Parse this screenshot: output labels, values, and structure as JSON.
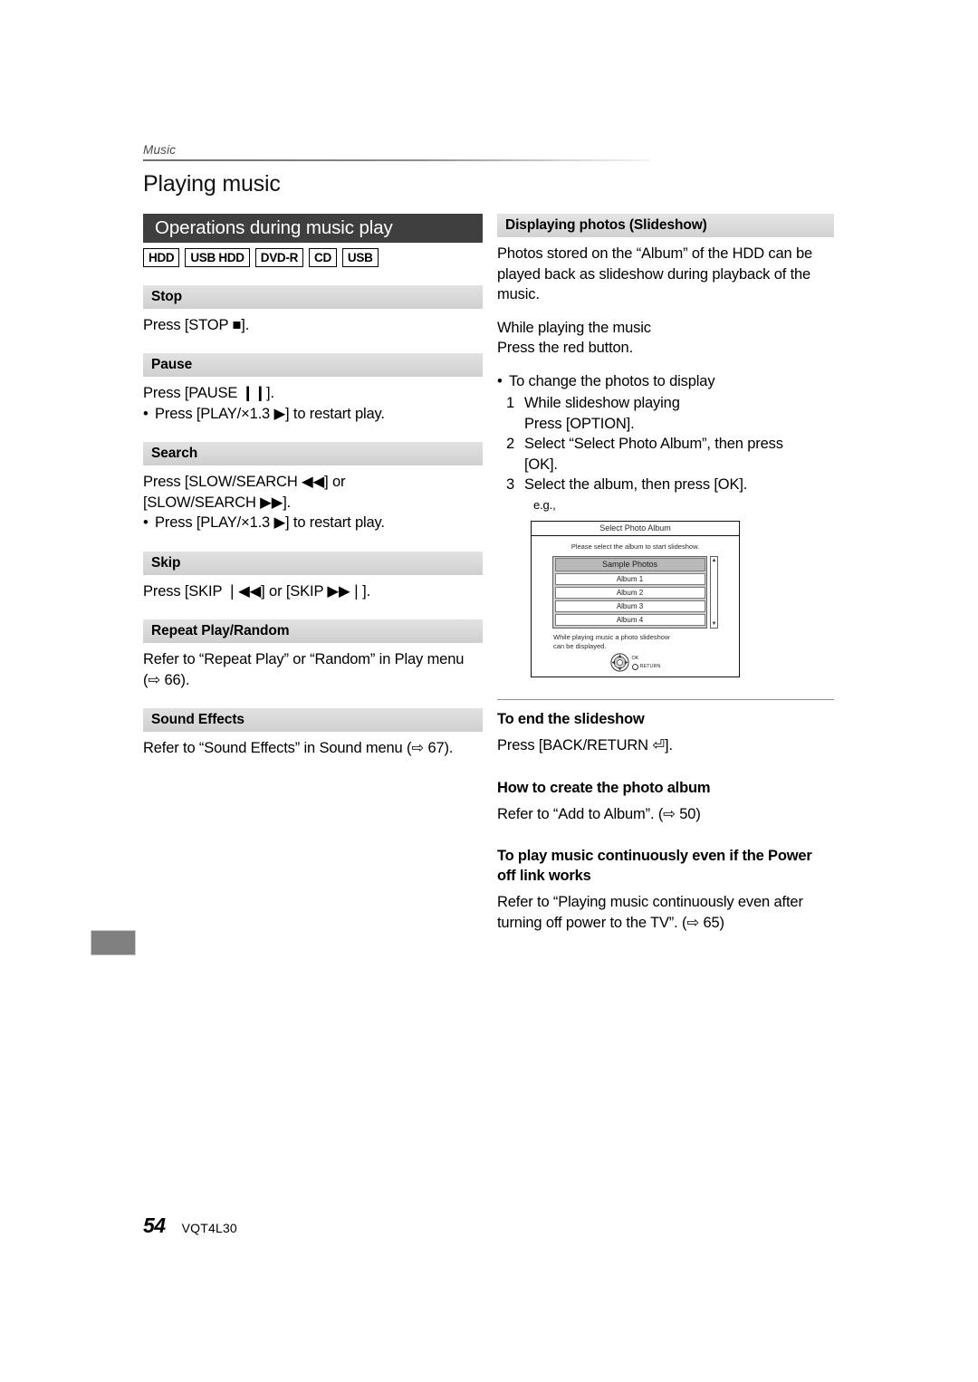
{
  "running_head": "Music",
  "page_title": "Playing music",
  "left_column": {
    "banner": "Operations during music play",
    "media_badges": [
      "HDD",
      "USB HDD",
      "DVD-R",
      "CD",
      "USB"
    ],
    "sections": [
      {
        "heading": "Stop",
        "lines": [
          "Press [STOP ■]."
        ],
        "bullets": []
      },
      {
        "heading": "Pause",
        "lines": [
          "Press [PAUSE ❙❙]."
        ],
        "bullets": [
          "Press [PLAY/×1.3 ▶] to restart play."
        ]
      },
      {
        "heading": "Search",
        "lines": [
          "Press [SLOW/SEARCH ◀◀] or",
          "[SLOW/SEARCH ▶▶]."
        ],
        "bullets": [
          "Press [PLAY/×1.3 ▶] to restart play."
        ]
      },
      {
        "heading": "Skip",
        "lines": [
          "Press [SKIP ❘◀◀] or [SKIP ▶▶❘]."
        ],
        "bullets": []
      },
      {
        "heading": "Repeat Play/Random",
        "lines": [
          "Refer to “Repeat Play” or “Random” in Play menu",
          "(⇨ 66)."
        ],
        "bullets": []
      },
      {
        "heading": "Sound Effects",
        "lines": [
          "Refer to “Sound Effects” in Sound menu (⇨ 67)."
        ],
        "bullets": []
      }
    ]
  },
  "right_column": {
    "heading": "Displaying photos (Slideshow)",
    "intro": [
      "Photos stored on the “Album” of the HDD can be",
      "played back as slideshow during playback of the",
      "music."
    ],
    "while_playing": [
      "While playing the music",
      "Press the red button."
    ],
    "change_photos_bullet": "To change the photos to display",
    "steps": [
      {
        "num": "1",
        "lines": [
          "While slideshow playing",
          "Press [OPTION]."
        ]
      },
      {
        "num": "2",
        "lines": [
          "Select “Select Photo Album”, then press",
          "[OK]."
        ]
      },
      {
        "num": "3",
        "lines": [
          "Select the album, then press [OK]."
        ]
      }
    ],
    "eg_label": "e.g.,",
    "mockup": {
      "title": "Select Photo Album",
      "subtitle": "Please select the album to start slideshow.",
      "list_header": "Sample Photos",
      "list_items": [
        "Album 1",
        "Album 2",
        "Album 3",
        "Album 4"
      ],
      "footnote": [
        "While playing music a photo slideshow",
        "can be displayed."
      ],
      "key_ok": "OK",
      "key_return": "RETURN"
    },
    "sub_sections": [
      {
        "heading": "To end the slideshow",
        "lines": [
          "Press [BACK/RETURN ⏎]."
        ]
      },
      {
        "heading": "How to create the photo album",
        "lines": [
          "Refer to “Add to Album”. (⇨ 50)"
        ]
      },
      {
        "heading": "To play music continuously even if the Power off link works",
        "lines": [
          "Refer to “Playing music continuously even after",
          "turning off power to the TV”. (⇨ 65)"
        ]
      }
    ]
  },
  "footer": {
    "page_number": "54",
    "model_code": "VQT4L30"
  },
  "colors": {
    "banner_bg": "#3f3f3f",
    "section_header_bg": "#dadada",
    "margin_tab": "#808080",
    "rule": "#8d8d8d"
  }
}
